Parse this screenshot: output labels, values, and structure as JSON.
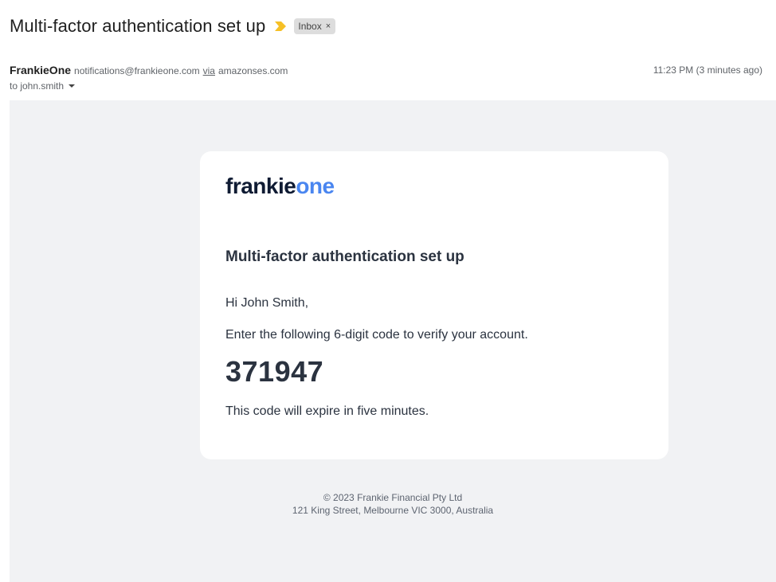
{
  "subject": "Multi-factor authentication set up",
  "label": {
    "text": "Inbox",
    "remove": "×"
  },
  "sender": {
    "name": "FrankieOne",
    "email": "notifications@frankieone.com",
    "via": "via",
    "via_domain": "amazonses.com",
    "time": "11:23 PM (3 minutes ago)",
    "to": "to john.smith"
  },
  "icons": {
    "importance": "importance-marker-icon",
    "caret": "chevron-down-icon"
  },
  "colors": {
    "importance": "#f6c026",
    "logo_dark": "#0f1b33",
    "logo_blue": "#4a86f0",
    "body_bg": "#f1f2f4"
  },
  "email": {
    "logo_part1": "frankie",
    "logo_part2": "one",
    "title": "Multi-factor authentication set up",
    "greeting": "Hi John Smith,",
    "instruction": "Enter the following 6-digit code to verify your account.",
    "code": "371947",
    "expiry": "This code will expire in five minutes.",
    "footer_line1": "© 2023 Frankie Financial Pty Ltd",
    "footer_line2": "121 King Street, Melbourne VIC 3000, Australia"
  }
}
